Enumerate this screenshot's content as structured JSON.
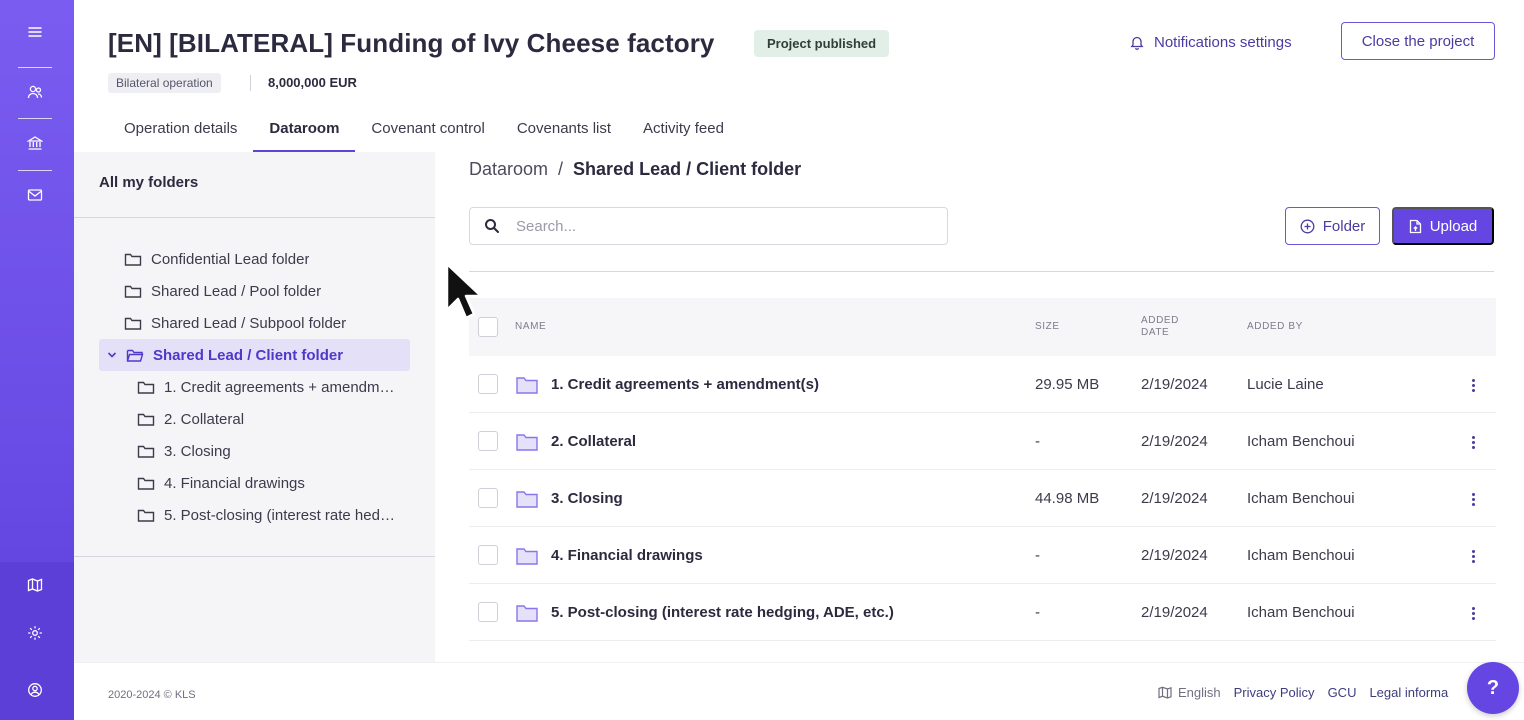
{
  "project": {
    "title": "[EN] [BILATERAL] Funding of Ivy Cheese factory",
    "status": "Project published",
    "type": "Bilateral operation",
    "amount": "8,000,000 EUR"
  },
  "header": {
    "notifications_label": "Notifications settings",
    "close_label": "Close the project"
  },
  "tabs": [
    {
      "label": "Operation details",
      "active": false
    },
    {
      "label": "Dataroom",
      "active": true
    },
    {
      "label": "Covenant control",
      "active": false
    },
    {
      "label": "Covenants list",
      "active": false
    },
    {
      "label": "Activity feed",
      "active": false
    }
  ],
  "tree": {
    "heading": "All my folders",
    "items": [
      {
        "label": "Confidential Lead folder",
        "level": 0
      },
      {
        "label": "Shared Lead / Pool folder",
        "level": 0
      },
      {
        "label": "Shared Lead / Subpool folder",
        "level": 0
      },
      {
        "label": "Shared Lead / Client folder",
        "level": 0,
        "selected": true,
        "expanded": true
      },
      {
        "label": "1. Credit agreements + amendment(s)",
        "level": 1
      },
      {
        "label": "2. Collateral",
        "level": 1
      },
      {
        "label": "3. Closing",
        "level": 1
      },
      {
        "label": "4. Financial drawings",
        "level": 1
      },
      {
        "label": "5. Post-closing (interest rate hedging, ADE, etc.)",
        "level": 1
      }
    ]
  },
  "breadcrumb": {
    "root": "Dataroom",
    "separator": "/",
    "current": "Shared Lead / Client folder"
  },
  "search": {
    "placeholder": "Search...",
    "value": ""
  },
  "actions": {
    "folder_label": "Folder",
    "upload_label": "Upload"
  },
  "table": {
    "headers": {
      "name": "Name",
      "size": "Size",
      "added_date": "Added date",
      "added_by": "Added by"
    },
    "rows": [
      {
        "name": "1. Credit agreements + amendment(s)",
        "size": "29.95 MB",
        "date": "2/19/2024",
        "by": "Lucie Laine"
      },
      {
        "name": "2. Collateral",
        "size": "-",
        "date": "2/19/2024",
        "by": "Icham Benchoui"
      },
      {
        "name": "3. Closing",
        "size": "44.98 MB",
        "date": "2/19/2024",
        "by": "Icham Benchoui"
      },
      {
        "name": "4. Financial drawings",
        "size": "-",
        "date": "2/19/2024",
        "by": "Icham Benchoui"
      },
      {
        "name": "5. Post-closing (interest rate hedging, ADE, etc.)",
        "size": "-",
        "date": "2/19/2024",
        "by": "Icham Benchoui"
      }
    ]
  },
  "footer": {
    "copyright": "2020-2024 © KLS",
    "language": "English",
    "privacy": "Privacy Policy",
    "gcu": "GCU",
    "legal": "Legal informa"
  },
  "help_label": "?",
  "colors": {
    "accent": "#6646e3",
    "rail": "#6a4de6",
    "selected_bg": "#e4e0f8",
    "published_badge": "#e2efe8"
  }
}
